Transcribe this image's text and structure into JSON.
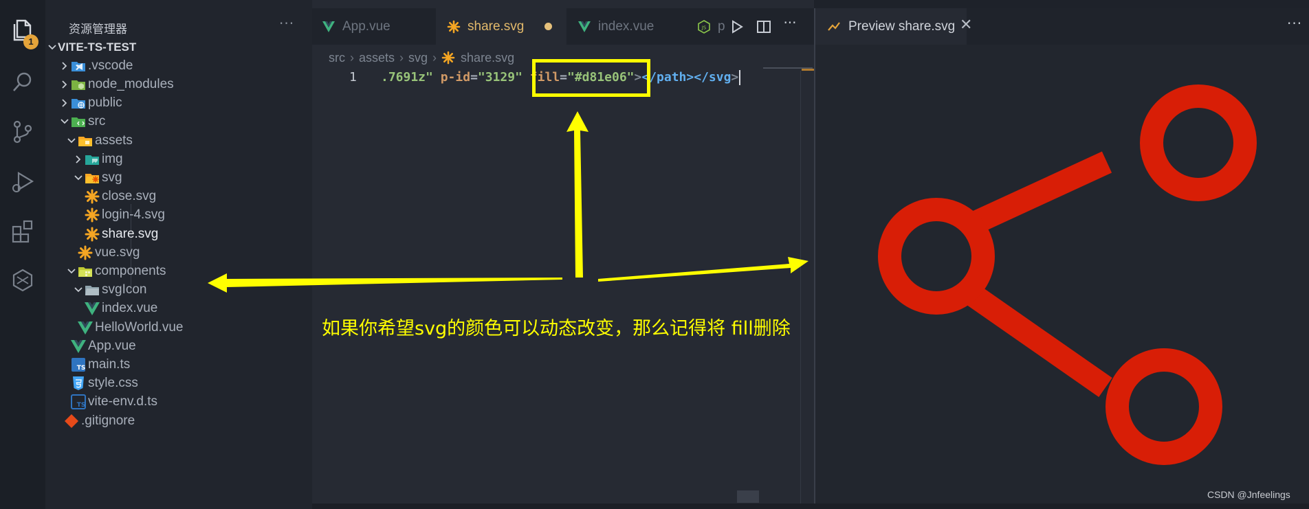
{
  "activity_bar": {
    "explorer_badge": "1",
    "icons": [
      "files-icon",
      "search-icon",
      "source-control-icon",
      "run-debug-icon",
      "extensions-icon",
      "remote-explorer-icon"
    ]
  },
  "sidebar": {
    "title": "资源管理器",
    "more": "···",
    "tree": [
      {
        "label": "VITE-TS-TEST",
        "depth": 0,
        "kind": "root",
        "expanded": true
      },
      {
        "label": ".vscode",
        "depth": 1,
        "kind": "folder-vscode",
        "expanded": false
      },
      {
        "label": "node_modules",
        "depth": 1,
        "kind": "folder-node",
        "expanded": false
      },
      {
        "label": "public",
        "depth": 1,
        "kind": "folder-public",
        "expanded": false
      },
      {
        "label": "src",
        "depth": 1,
        "kind": "folder-src",
        "expanded": true
      },
      {
        "label": "assets",
        "depth": 2,
        "kind": "folder-assets",
        "expanded": true
      },
      {
        "label": "img",
        "depth": 3,
        "kind": "folder-img",
        "expanded": false
      },
      {
        "label": "svg",
        "depth": 3,
        "kind": "folder-svg",
        "expanded": true
      },
      {
        "label": "close.svg",
        "depth": 4,
        "kind": "file-svg"
      },
      {
        "label": "login-4.svg",
        "depth": 4,
        "kind": "file-svg"
      },
      {
        "label": "share.svg",
        "depth": 4,
        "kind": "file-svg",
        "active": true
      },
      {
        "label": "vue.svg",
        "depth": 3,
        "kind": "file-svg"
      },
      {
        "label": "components",
        "depth": 2,
        "kind": "folder-components",
        "expanded": true
      },
      {
        "label": "svgIcon",
        "depth": 3,
        "kind": "folder-plain",
        "expanded": true
      },
      {
        "label": "index.vue",
        "depth": 4,
        "kind": "file-vue"
      },
      {
        "label": "HelloWorld.vue",
        "depth": 3,
        "kind": "file-vue"
      },
      {
        "label": "App.vue",
        "depth": 2,
        "kind": "file-vue"
      },
      {
        "label": "main.ts",
        "depth": 2,
        "kind": "file-ts"
      },
      {
        "label": "style.css",
        "depth": 2,
        "kind": "file-css"
      },
      {
        "label": "vite-env.d.ts",
        "depth": 2,
        "kind": "file-dts"
      },
      {
        "label": ".gitignore",
        "depth": 1,
        "kind": "file-git"
      }
    ]
  },
  "editor": {
    "tabs": [
      {
        "label": "App.vue",
        "icon": "vue-icon",
        "active": false
      },
      {
        "label": "share.svg",
        "icon": "svg-file-icon",
        "active": true,
        "dirty": true
      },
      {
        "label": "index.vue",
        "icon": "vue-icon",
        "active": false
      },
      {
        "label": "p",
        "icon": "js-icon",
        "active": false
      }
    ],
    "breadcrumb": [
      "src",
      "assets",
      "svg",
      "share.svg"
    ],
    "line_number": "1",
    "code": {
      "t1": ".7691z\"",
      "t2": "p-id",
      "t3": "=",
      "t4": "\"3129\"",
      "t5": "fill",
      "t6": "=",
      "t7": "\"#d81e06\"",
      "t8": ">",
      "t9": "</path>",
      "t10": "</svg",
      "t11": ">"
    }
  },
  "preview": {
    "tab_label": "Preview share.svg",
    "close": "✕",
    "more": "···",
    "fill_color": "#d81e06"
  },
  "annotation": {
    "text": "如果你希望svg的颜色可以动态改变，那么记得将 fill删除",
    "color": "#ffff00"
  },
  "watermark": "CSDN @Jnfeelings"
}
